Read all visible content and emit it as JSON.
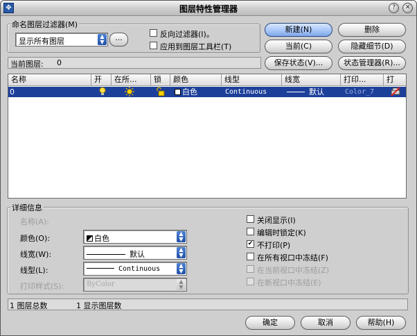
{
  "window": {
    "title": "图层特性管理器",
    "help_glyph": "?",
    "close_glyph": "✕"
  },
  "filter": {
    "legend": "命名图层过滤器(M)",
    "selected": "显示所有图层",
    "dots_label": "...",
    "invert_label": "反向过滤器(I)。",
    "apply_label": "应用到图层工具栏(T)"
  },
  "buttons": {
    "new": "新建(N)",
    "delete": "删除",
    "current": "当前(C)",
    "hide_details": "隐藏细节(D)",
    "save_state": "保存状态(V)...",
    "state_manager": "状态管理器(R)...",
    "ok": "确定",
    "cancel": "取消",
    "help": "帮助(H)"
  },
  "current_layer": {
    "label": "当前图层:",
    "value": "0"
  },
  "table": {
    "headers": [
      "名称",
      "开",
      "在所...",
      "锁",
      "颜色",
      "线型",
      "线宽",
      "打印...",
      "打"
    ],
    "rows": [
      {
        "name": "0",
        "color": "白色",
        "linetype": "Continuous",
        "lineweight": "默认",
        "plotstyle": "Color_7"
      }
    ]
  },
  "details": {
    "legend": "详细信息",
    "name_label": "名称(A):",
    "color_label": "颜色(O):",
    "color_value": "白色",
    "lineweight_label": "线宽(W):",
    "lineweight_value": "默认",
    "linetype_label": "线型(L):",
    "linetype_value": "Continuous",
    "plotstyle_label": "打印样式(S):",
    "plotstyle_value": "ByColor",
    "checks": [
      {
        "label": "关闭显示(I)",
        "checked": false,
        "disabled": false
      },
      {
        "label": "编辑时锁定(K)",
        "checked": false,
        "disabled": false
      },
      {
        "label": "不打印(P)",
        "checked": true,
        "disabled": false
      },
      {
        "label": "在所有视口中冻结(F)",
        "checked": false,
        "disabled": false
      },
      {
        "label": "在当前视口中冻结(Z)",
        "checked": false,
        "disabled": true
      },
      {
        "label": "在新视口中冻结(E)",
        "checked": false,
        "disabled": true
      }
    ]
  },
  "status": {
    "total": "1 图层总数",
    "shown": "1 显示图层数"
  },
  "colors": {
    "selection": "#1c3f9a",
    "window_bg": "#cfcfcf",
    "accent_arrow": "#2150a8"
  }
}
